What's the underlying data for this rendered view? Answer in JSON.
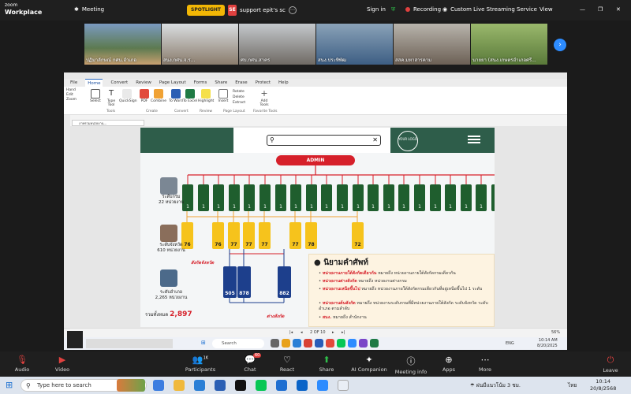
{
  "zoom": {
    "logo_top": "zoom",
    "logo_bottom": "Workplace",
    "meeting_label": "Meeting",
    "spotlight": "SPOTLIGHT",
    "share_tag": "SE",
    "share_title": "support epit's sc",
    "signin": "Sign in",
    "recording": "Recording",
    "live": "Custom Live Streaming Service",
    "view": "View"
  },
  "participants": [
    {
      "name": "ปฏิมาลักษณ์ กศน.อำเภอ"
    },
    {
      "name": "สนง.กศน.จ.ร..."
    },
    {
      "name": "ศบ.กศน.สาคร"
    },
    {
      "name": "สนง.ประทิพัฒ"
    },
    {
      "name": "สสค.มหาสารคาม"
    },
    {
      "name": "นายยา (สนง.เกษตรอำเภอศรี..."
    }
  ],
  "app": {
    "menus": [
      "File",
      "Home",
      "Convert",
      "Review",
      "Page Layout",
      "Forms",
      "Share",
      "Erase",
      "Protect",
      "Help"
    ],
    "active_menu": "Home",
    "ribbon_buttons": [
      "Select",
      "Type Tool",
      "QuickSign",
      "PDF",
      "Combine",
      "To Word",
      "To Excel",
      "Highlight",
      "Insert",
      "Rotate",
      "Delete",
      "Extract",
      "Add Tools"
    ],
    "ribbon_groups": [
      "Tools",
      "Create",
      "Convert",
      "Review",
      "Page Layout",
      "Favorite Tools"
    ],
    "left_tools": [
      "Hand",
      "Edit",
      "Zoom"
    ],
    "doc_tab": "ภาพรวมหน่วยงาน...",
    "page_indicator": "2 OF 10",
    "zoom_level": "56%"
  },
  "slide": {
    "admin_label": "ADMIN",
    "logo_text": "YOUR LOGO",
    "levels": [
      {
        "label": "ระดับกรม",
        "count": "22 หน่วยงาน"
      },
      {
        "label": "ระดับจังหวัด",
        "count": "610 หน่วยงาน"
      },
      {
        "label": "ระดับอำเภอ",
        "count": "2,265 หน่วยงาน"
      }
    ],
    "green_values": [
      "1",
      "1",
      "1",
      "1",
      "1",
      "1",
      "1",
      "1",
      "1",
      "1",
      "1",
      "1",
      "1",
      "1",
      "1",
      "1",
      "1",
      "1",
      "1",
      "1",
      "1",
      "1"
    ],
    "yellow_values": [
      "76",
      "76",
      "77",
      "77",
      "77",
      "77",
      "78",
      "72"
    ],
    "blue_values": [
      "505",
      "878",
      "882"
    ],
    "label_provincial": "สังกัดจังหวัด",
    "label_district": "ต่างสังกัด",
    "total_label": "รวมทั้งหมด",
    "total_value": "2,897",
    "definitions_title": "นิยามคำศัพท์",
    "definitions": [
      {
        "term": "หน่วยงานภายใต้สังกัดเดียวกัน",
        "desc": "หมายถึง หน่วยงานภายใต้สังกัดกรมเดียวกัน"
      },
      {
        "term": "หน่วยงานต่างสังกัด",
        "desc": "หมายถึง หน่วยงานต่างกรม"
      },
      {
        "term": "หน่วยงานเหนือขึ้นไป",
        "desc": "หมายถึง หน่วยงานภายใต้สังกัดกรมเดียวกันที่อยู่เหนือขึ้นไป 1 ระดับ"
      },
      {
        "term": "หน่วยงานต้นสังกัด",
        "desc": "หมายถึง หน่วยงานระดับกรมที่มีหน่วยงานภายใต้สังกัด ระดับจังหวัด ระดับอำเภอ ตามลำดับ"
      },
      {
        "term": "สนง.",
        "desc": "หมายถึง สำนักงาน"
      }
    ]
  },
  "controls": {
    "audio": "Audio",
    "video": "Video",
    "participants": "Participants",
    "participants_count": "1K",
    "chat": "Chat",
    "chat_badge": "60",
    "react": "React",
    "share": "Share",
    "ai": "AI Companion",
    "info": "Meeting info",
    "apps": "Apps",
    "more": "More",
    "leave": "Leave"
  },
  "windows": {
    "search_placeholder": "Type here to search",
    "weather": "ฝนมีแนวโน้ม 3 ชม.",
    "lang": "ไทย",
    "time": "10:14",
    "date": "20/8/2568"
  },
  "remote_taskbar": {
    "search": "Search",
    "lang": "ENG",
    "time": "10:14 AM",
    "date": "8/20/2025"
  }
}
